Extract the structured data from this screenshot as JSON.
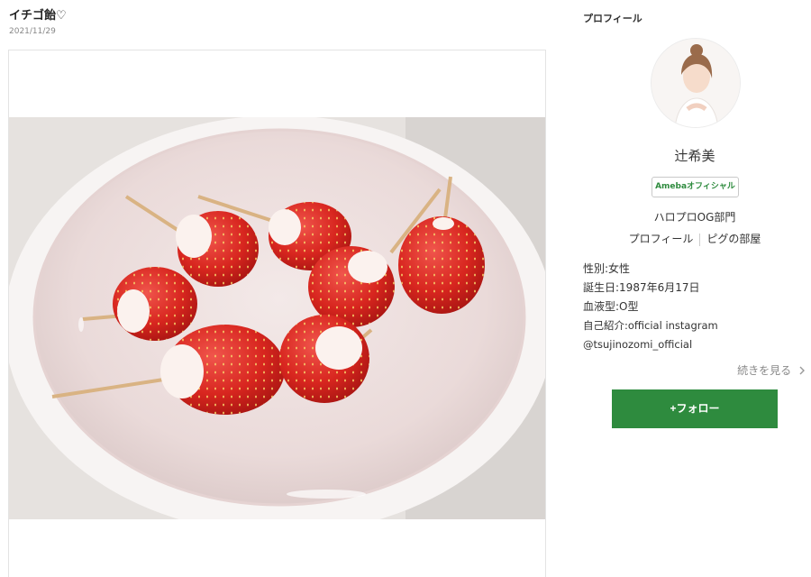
{
  "post": {
    "title": "イチゴ飴♡",
    "date": "2021/11/29",
    "photo_icon": "strawberry-candy-photo"
  },
  "profile": {
    "heading": "プロフィール",
    "name": "辻希美",
    "badge": "Amebaオフィシャル",
    "group": "ハロプロOG部門",
    "links": [
      "プロフィール",
      "ピグの部屋"
    ],
    "gender": "性別:女性",
    "birthday": "誕生日:1987年6月17日",
    "blood": "血液型:O型",
    "intro": "自己紹介:official instagram @tsujinozomi_official",
    "more": "続きを見る",
    "follow": "+フォロー"
  },
  "colors": {
    "brand_green": "#2e8b3e"
  }
}
